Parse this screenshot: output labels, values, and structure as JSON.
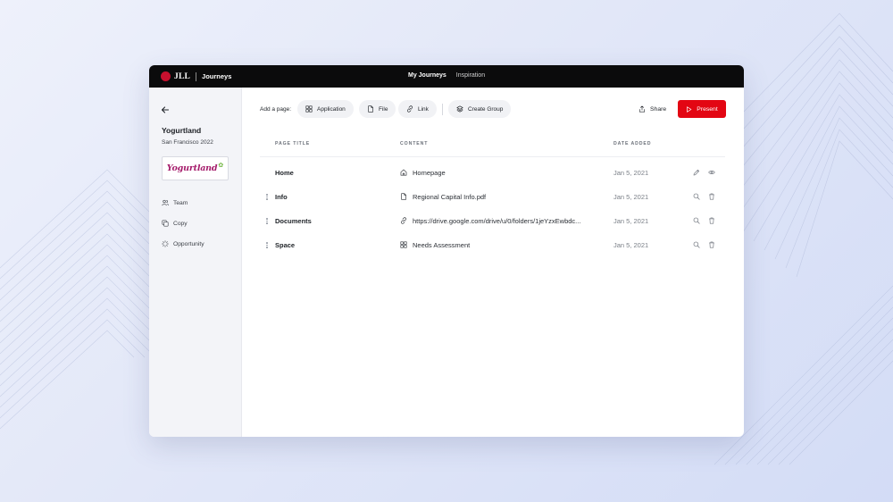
{
  "app": {
    "brand": "JLL",
    "product": "Journeys",
    "nav": [
      {
        "label": "My Journeys",
        "active": true
      },
      {
        "label": "Inspiration",
        "active": false
      }
    ]
  },
  "sidebar": {
    "back_icon": "arrow-left-icon",
    "company": "Yogurtland",
    "subtitle": "San Francisco 2022",
    "logo_text": "Yogurtland",
    "items": [
      {
        "label": "Team",
        "icon": "users-icon"
      },
      {
        "label": "Copy",
        "icon": "copy-icon"
      },
      {
        "label": "Opportunity",
        "icon": "sparkle-icon"
      }
    ]
  },
  "toolbar": {
    "add_label": "Add a page:",
    "chips": [
      {
        "label": "Application",
        "icon": "grid-icon"
      },
      {
        "label": "File",
        "icon": "file-icon"
      },
      {
        "label": "Link",
        "icon": "link-icon"
      },
      {
        "label": "Create Group",
        "icon": "layers-icon"
      }
    ],
    "share_label": "Share",
    "present_label": "Present"
  },
  "table": {
    "columns": [
      "PAGE TITLE",
      "CONTENT",
      "DATE ADDED"
    ],
    "rows": [
      {
        "title": "Home",
        "content_icon": "home-icon",
        "content": "Homepage",
        "date": "Jan 5, 2021",
        "actions": [
          "edit-icon",
          "eye-icon"
        ],
        "draggable": false
      },
      {
        "title": "Info",
        "content_icon": "file-icon",
        "content": "Regional Capital Info.pdf",
        "date": "Jan 5, 2021",
        "actions": [
          "search-icon",
          "trash-icon"
        ],
        "draggable": true
      },
      {
        "title": "Documents",
        "content_icon": "link-icon",
        "content": "https://drive.google.com/drive/u/0/folders/1jeYzxEwbdc...",
        "date": "Jan 5, 2021",
        "actions": [
          "search-icon",
          "trash-icon"
        ],
        "draggable": true
      },
      {
        "title": "Space",
        "content_icon": "grid-icon",
        "content": "Needs Assessment",
        "date": "Jan 5, 2021",
        "actions": [
          "search-icon",
          "trash-icon"
        ],
        "draggable": true
      }
    ]
  },
  "colors": {
    "topbar": "#0b0b0c",
    "accent_red": "#e30613",
    "brand_magenta": "#a51c6b"
  }
}
